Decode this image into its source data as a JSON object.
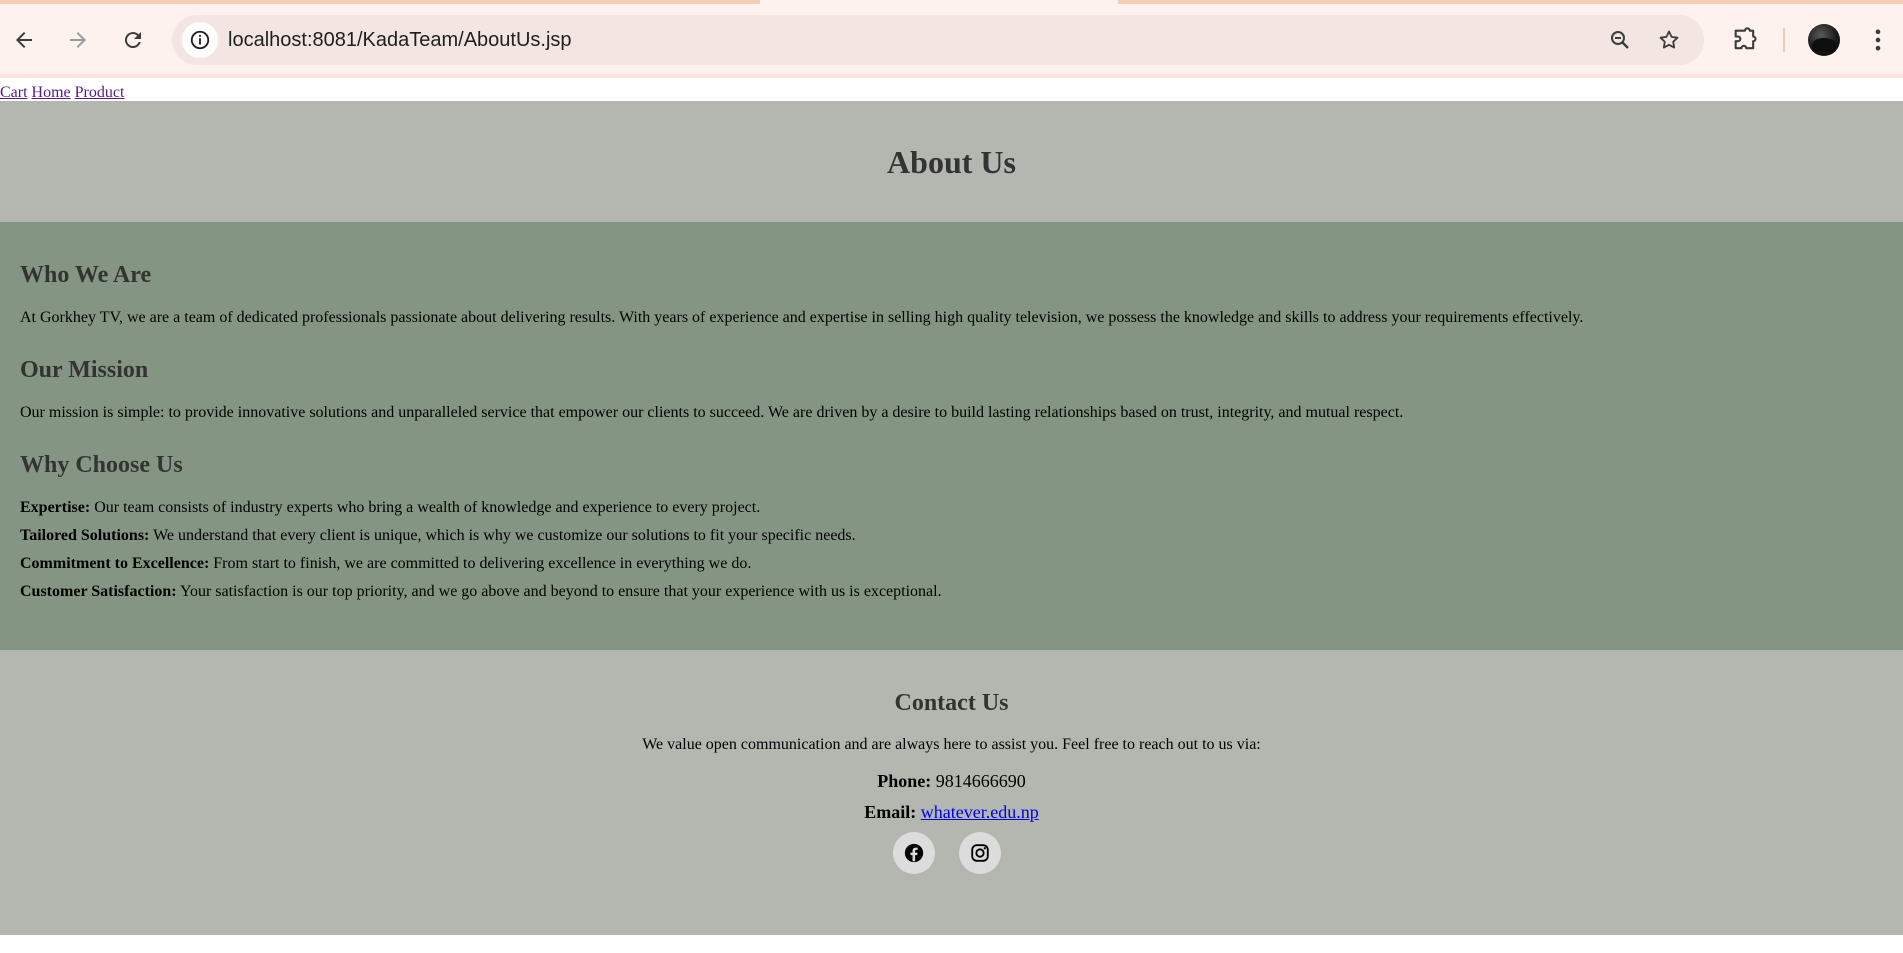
{
  "browser": {
    "url_host": "localhost",
    "url_path": ":8081/KadaTeam/AboutUs.jsp",
    "icons": {
      "back": "arrow-left-icon",
      "forward": "arrow-right-icon",
      "reload": "reload-icon",
      "site_info": "info-icon",
      "zoom": "zoom-icon",
      "bookmark": "star-icon",
      "extensions": "puzzle-icon",
      "profile": "avatar",
      "menu": "kebab-menu-icon"
    }
  },
  "nav": {
    "links": [
      "Cart",
      "Home",
      "Product"
    ]
  },
  "hero": {
    "title": "About Us"
  },
  "about": {
    "who_heading": "Who We Are",
    "who_text": "At Gorkhey TV, we are a team of dedicated professionals passionate about delivering results. With years of experience and expertise in selling high quality television, we possess the knowledge and skills to address your requirements effectively.",
    "mission_heading": "Our Mission",
    "mission_text": "Our mission is simple: to provide innovative solutions and unparalleled service that empower our clients to succeed. We are driven by a desire to build lasting relationships based on trust, integrity, and mutual respect.",
    "why_heading": "Why Choose Us",
    "reasons": [
      {
        "label": "Expertise:",
        "text": "Our team consists of industry experts who bring a wealth of knowledge and experience to every project."
      },
      {
        "label": "Tailored Solutions:",
        "text": "We understand that every client is unique, which is why we customize our solutions to fit your specific needs."
      },
      {
        "label": "Commitment to Excellence:",
        "text": "From start to finish, we are committed to delivering excellence in everything we do."
      },
      {
        "label": "Customer Satisfaction:",
        "text": "Your satisfaction is our top priority, and we go above and beyond to ensure that your experience with us is exceptional."
      }
    ]
  },
  "contact": {
    "heading": "Contact Us",
    "intro": "We value open communication and are always here to assist you. Feel free to reach out to us via:",
    "phone_label": "Phone:",
    "phone_value": "9814666690",
    "email_label": "Email:",
    "email_value": "whatever.edu.np",
    "social": [
      "facebook-icon",
      "instagram-icon"
    ]
  },
  "colors": {
    "hero_bg": "#b3b7b0",
    "about_bg": "#849683",
    "heading": "#333333",
    "link_visited": "#551a8b",
    "link": "#0000ee"
  }
}
